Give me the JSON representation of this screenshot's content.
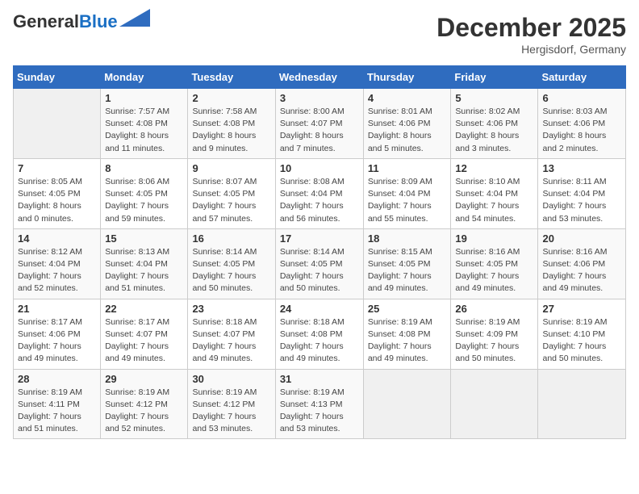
{
  "header": {
    "logo_general": "General",
    "logo_blue": "Blue",
    "month_title": "December 2025",
    "subtitle": "Hergisdorf, Germany"
  },
  "days_of_week": [
    "Sunday",
    "Monday",
    "Tuesday",
    "Wednesday",
    "Thursday",
    "Friday",
    "Saturday"
  ],
  "weeks": [
    [
      {
        "day": "",
        "info": ""
      },
      {
        "day": "1",
        "info": "Sunrise: 7:57 AM\nSunset: 4:08 PM\nDaylight: 8 hours\nand 11 minutes."
      },
      {
        "day": "2",
        "info": "Sunrise: 7:58 AM\nSunset: 4:08 PM\nDaylight: 8 hours\nand 9 minutes."
      },
      {
        "day": "3",
        "info": "Sunrise: 8:00 AM\nSunset: 4:07 PM\nDaylight: 8 hours\nand 7 minutes."
      },
      {
        "day": "4",
        "info": "Sunrise: 8:01 AM\nSunset: 4:06 PM\nDaylight: 8 hours\nand 5 minutes."
      },
      {
        "day": "5",
        "info": "Sunrise: 8:02 AM\nSunset: 4:06 PM\nDaylight: 8 hours\nand 3 minutes."
      },
      {
        "day": "6",
        "info": "Sunrise: 8:03 AM\nSunset: 4:06 PM\nDaylight: 8 hours\nand 2 minutes."
      }
    ],
    [
      {
        "day": "7",
        "info": "Sunrise: 8:05 AM\nSunset: 4:05 PM\nDaylight: 8 hours\nand 0 minutes."
      },
      {
        "day": "8",
        "info": "Sunrise: 8:06 AM\nSunset: 4:05 PM\nDaylight: 7 hours\nand 59 minutes."
      },
      {
        "day": "9",
        "info": "Sunrise: 8:07 AM\nSunset: 4:05 PM\nDaylight: 7 hours\nand 57 minutes."
      },
      {
        "day": "10",
        "info": "Sunrise: 8:08 AM\nSunset: 4:04 PM\nDaylight: 7 hours\nand 56 minutes."
      },
      {
        "day": "11",
        "info": "Sunrise: 8:09 AM\nSunset: 4:04 PM\nDaylight: 7 hours\nand 55 minutes."
      },
      {
        "day": "12",
        "info": "Sunrise: 8:10 AM\nSunset: 4:04 PM\nDaylight: 7 hours\nand 54 minutes."
      },
      {
        "day": "13",
        "info": "Sunrise: 8:11 AM\nSunset: 4:04 PM\nDaylight: 7 hours\nand 53 minutes."
      }
    ],
    [
      {
        "day": "14",
        "info": "Sunrise: 8:12 AM\nSunset: 4:04 PM\nDaylight: 7 hours\nand 52 minutes."
      },
      {
        "day": "15",
        "info": "Sunrise: 8:13 AM\nSunset: 4:04 PM\nDaylight: 7 hours\nand 51 minutes."
      },
      {
        "day": "16",
        "info": "Sunrise: 8:14 AM\nSunset: 4:05 PM\nDaylight: 7 hours\nand 50 minutes."
      },
      {
        "day": "17",
        "info": "Sunrise: 8:14 AM\nSunset: 4:05 PM\nDaylight: 7 hours\nand 50 minutes."
      },
      {
        "day": "18",
        "info": "Sunrise: 8:15 AM\nSunset: 4:05 PM\nDaylight: 7 hours\nand 49 minutes."
      },
      {
        "day": "19",
        "info": "Sunrise: 8:16 AM\nSunset: 4:05 PM\nDaylight: 7 hours\nand 49 minutes."
      },
      {
        "day": "20",
        "info": "Sunrise: 8:16 AM\nSunset: 4:06 PM\nDaylight: 7 hours\nand 49 minutes."
      }
    ],
    [
      {
        "day": "21",
        "info": "Sunrise: 8:17 AM\nSunset: 4:06 PM\nDaylight: 7 hours\nand 49 minutes."
      },
      {
        "day": "22",
        "info": "Sunrise: 8:17 AM\nSunset: 4:07 PM\nDaylight: 7 hours\nand 49 minutes."
      },
      {
        "day": "23",
        "info": "Sunrise: 8:18 AM\nSunset: 4:07 PM\nDaylight: 7 hours\nand 49 minutes."
      },
      {
        "day": "24",
        "info": "Sunrise: 8:18 AM\nSunset: 4:08 PM\nDaylight: 7 hours\nand 49 minutes."
      },
      {
        "day": "25",
        "info": "Sunrise: 8:19 AM\nSunset: 4:08 PM\nDaylight: 7 hours\nand 49 minutes."
      },
      {
        "day": "26",
        "info": "Sunrise: 8:19 AM\nSunset: 4:09 PM\nDaylight: 7 hours\nand 50 minutes."
      },
      {
        "day": "27",
        "info": "Sunrise: 8:19 AM\nSunset: 4:10 PM\nDaylight: 7 hours\nand 50 minutes."
      }
    ],
    [
      {
        "day": "28",
        "info": "Sunrise: 8:19 AM\nSunset: 4:11 PM\nDaylight: 7 hours\nand 51 minutes."
      },
      {
        "day": "29",
        "info": "Sunrise: 8:19 AM\nSunset: 4:12 PM\nDaylight: 7 hours\nand 52 minutes."
      },
      {
        "day": "30",
        "info": "Sunrise: 8:19 AM\nSunset: 4:12 PM\nDaylight: 7 hours\nand 53 minutes."
      },
      {
        "day": "31",
        "info": "Sunrise: 8:19 AM\nSunset: 4:13 PM\nDaylight: 7 hours\nand 53 minutes."
      },
      {
        "day": "",
        "info": ""
      },
      {
        "day": "",
        "info": ""
      },
      {
        "day": "",
        "info": ""
      }
    ]
  ]
}
